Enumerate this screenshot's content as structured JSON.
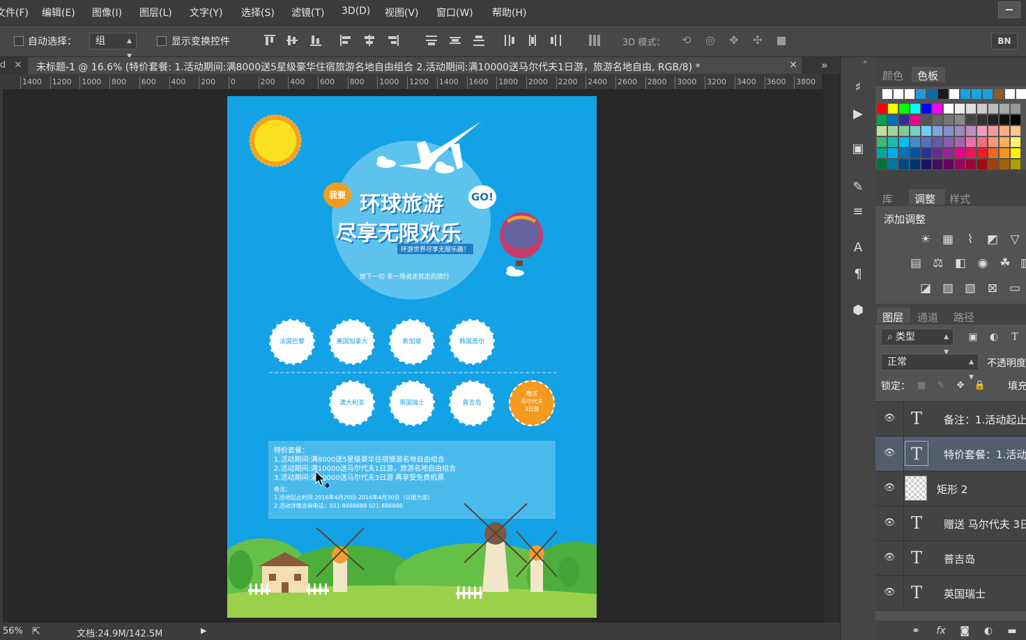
{
  "menu": [
    "文件(F)",
    "编辑(E)",
    "图像(I)",
    "图层(L)",
    "文字(Y)",
    "选择(S)",
    "滤镜(T)",
    "3D(D)",
    "视图(V)",
    "窗口(W)",
    "帮助(H)"
  ],
  "options": {
    "auto_select_label": "自动选择：",
    "auto_select_value": "组",
    "show_transform_label": "显示变换控件",
    "mode_3d_label": "3D 模式：",
    "bn_label": "BN"
  },
  "doc_tab": {
    "title": "未标题-1 @ 16.6% (特价套餐: 1.活动期间:满8000送5星级豪华住宿旅游名地自由组合 2.活动期间:满10000送马尔代夫1日游，旅游名地自由, RGB/8) *",
    "close": "×",
    "left_prefix": "d",
    "left_close": "×",
    "overflow": "»"
  },
  "ruler_ticks": [
    "1400",
    "1200",
    "1000",
    "800",
    "600",
    "400",
    "200",
    "0",
    "200",
    "400",
    "600",
    "800",
    "1000",
    "1200",
    "1400",
    "1600",
    "1800",
    "2000",
    "2200",
    "2400",
    "2600",
    "2800",
    "3000",
    "3200",
    "3400",
    "3600",
    "3800"
  ],
  "status": {
    "zoom": "56%",
    "doc": "文档:24.9M/142.5M"
  },
  "poster": {
    "badge": "我要",
    "title1": "环球旅游",
    "go": "GO!",
    "title2": "尽享无限欢乐",
    "subtitle": "环游世界尽享无限乐趣！",
    "tagline": "放下一切 来一场说走就走的旅行",
    "row1": [
      "法国巴黎",
      "美国加拿大",
      "新加坡",
      "韩国首尔"
    ],
    "row2": [
      "澳大利亚",
      "英国瑞士",
      "普吉岛"
    ],
    "gift": [
      "赠送",
      "马尔代夫",
      "3日游"
    ],
    "info_lines": [
      "特价套餐：",
      "1.活动期间:满8000送5星级豪华住宿旅游名地自由组合",
      "2.活动期间:满10000送马尔代夫1日游，旅游名地自由组合",
      "3.活动期间:满20000送马尔代夫3日游 再享受免费机票",
      "备注：",
      "1.活动起止时间:2016年4月20日-2016年4月30日（以图为准）",
      "2.活动详情咨询电话：021-8888888 021-888888"
    ]
  },
  "panels": {
    "tabs_top": [
      "颜色",
      "色板"
    ],
    "tabs_mid": [
      "库",
      "调整",
      "样式"
    ],
    "adjust_label": "添加调整",
    "tabs_layers": [
      "图层",
      "通道",
      "路径"
    ],
    "filter_label": "类型",
    "blend_mode": "正常",
    "opacity_label": "不透明度",
    "lock_label": "锁定：",
    "fill_label": "填充"
  },
  "layers": [
    {
      "name": "备注：1.活动起止",
      "type": "text",
      "selected": false
    },
    {
      "name": "特价套餐：1.活动",
      "type": "text",
      "selected": true
    },
    {
      "name": "矩形 2",
      "type": "shape",
      "selected": false
    },
    {
      "name": "赠送 马尔代夫 3日",
      "type": "text",
      "selected": false
    },
    {
      "name": "普吉岛",
      "type": "text",
      "selected": false
    },
    {
      "name": "英国瑞士",
      "type": "text",
      "selected": false
    }
  ],
  "colors": {
    "poster_bg": "#13a2e6",
    "accent_orange": "#f59a1f",
    "selection": "#535d6b"
  }
}
